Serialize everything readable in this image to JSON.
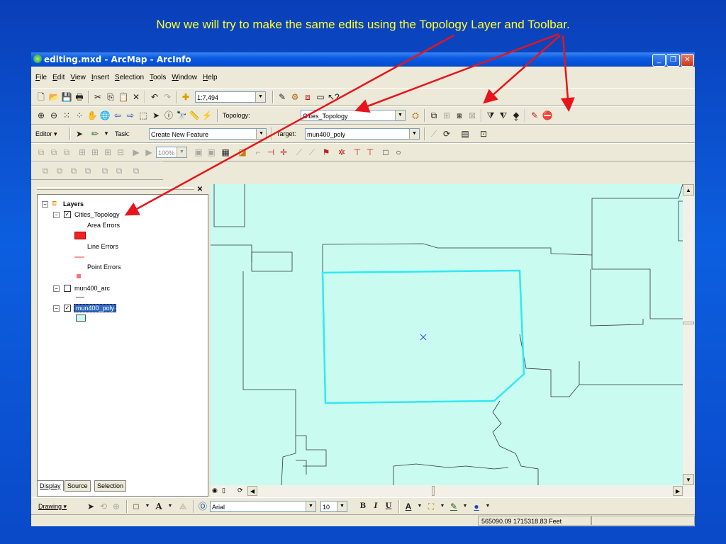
{
  "slide": {
    "caption": "Now we will try to make the same edits using the Topology Layer and Toolbar."
  },
  "window": {
    "title": "editing.mxd - ArcMap - ArcInfo"
  },
  "menu": [
    "File",
    "Edit",
    "View",
    "Insert",
    "Selection",
    "Tools",
    "Window",
    "Help"
  ],
  "standard_toolbar": {
    "scale": "1:7,494"
  },
  "topology_toolbar": {
    "label": "Topology:",
    "value": "Cities_Topology"
  },
  "editor_toolbar": {
    "editor_label": "Editor",
    "task_label": "Task:",
    "task_value": "Create New Feature",
    "target_label": "Target:",
    "target_value": "mun400_poly"
  },
  "advanced_toolbar": {
    "zoom": "100%"
  },
  "toc": {
    "root": "Layers",
    "layers": [
      {
        "name": "Cities_Topology",
        "checked": true
      },
      {
        "name": "mun400_arc",
        "checked": false
      },
      {
        "name": "mun400_poly",
        "checked": true
      }
    ],
    "legend": {
      "area": "Area Errors",
      "line": "Line Errors",
      "point": "Point Errors"
    },
    "tabs": [
      "Display",
      "Source",
      "Selection"
    ]
  },
  "drawing_toolbar": {
    "label": "Drawing",
    "font": "Arial",
    "size": "10",
    "bold": "B",
    "italic": "I",
    "underline": "U"
  },
  "status": {
    "coords": "565090.09  1715318.83 Feet"
  },
  "colors": {
    "map_fill": "#c9fbf0",
    "selection": "#33e8f0",
    "arrow": "#e8141c",
    "caption": "#ffff33",
    "area_error": "#ee2222",
    "line_error": "#ff9999",
    "point_error": "#ee7777"
  }
}
